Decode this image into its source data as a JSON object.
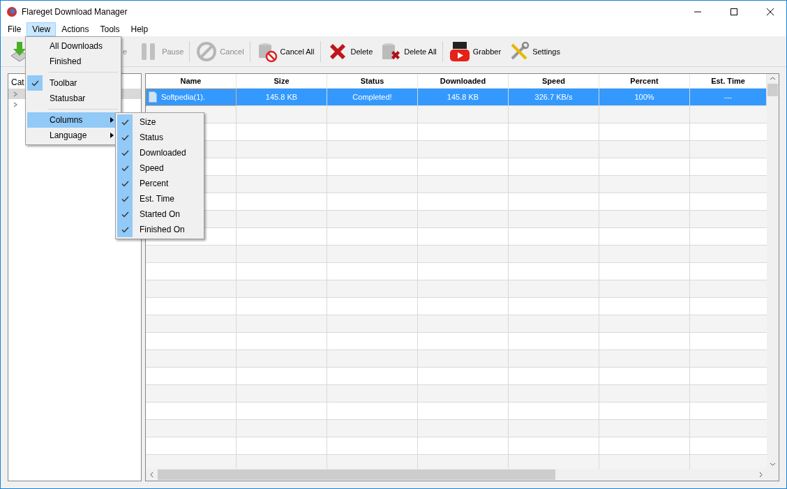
{
  "window": {
    "title": "Flareget Download Manager"
  },
  "menubar": [
    {
      "label": "File",
      "selected": false
    },
    {
      "label": "View",
      "selected": true
    },
    {
      "label": "Actions",
      "selected": false
    },
    {
      "label": "Tools",
      "selected": false
    },
    {
      "label": "Help",
      "selected": false
    }
  ],
  "toolbar": [
    {
      "kind": "add",
      "disabled": false
    },
    {
      "kind": "resume",
      "label": "e",
      "disabled": true
    },
    {
      "kind": "pause",
      "label": "Pause",
      "disabled": true
    },
    {
      "kind": "cancel",
      "label": "Cancel",
      "disabled": true
    },
    {
      "kind": "cancel-all",
      "label": "Cancel All",
      "disabled": false
    },
    {
      "kind": "delete",
      "label": "Delete",
      "disabled": false
    },
    {
      "kind": "delete-all",
      "label": "Delete All",
      "disabled": false
    },
    {
      "kind": "youtube",
      "label": "Grabber",
      "disabled": false
    },
    {
      "kind": "settings",
      "label": "Settings",
      "disabled": false
    }
  ],
  "sidebar": {
    "header": "Cat",
    "items": [
      {
        "selected": true,
        "expanded": false
      },
      {
        "selected": false,
        "expanded": false
      }
    ]
  },
  "table": {
    "columns": [
      "Name",
      "Size",
      "Status",
      "Downloaded",
      "Speed",
      "Percent",
      "Est. Time"
    ],
    "rows": [
      {
        "selected": true,
        "cells": [
          "Softpedia(1).",
          "145.8 KB",
          "Completed!",
          "145.8 KB",
          "326.7 KB/s",
          "100%",
          "---"
        ]
      }
    ]
  },
  "view_menu": [
    {
      "kind": "item",
      "label": "All Downloads",
      "checked": false,
      "selected": false,
      "submenu": false
    },
    {
      "kind": "item",
      "label": "Finished",
      "checked": false,
      "selected": false,
      "submenu": false
    },
    {
      "kind": "separator"
    },
    {
      "kind": "item",
      "label": "Toolbar",
      "checked": true,
      "selected": false,
      "submenu": false
    },
    {
      "kind": "item",
      "label": "Statusbar",
      "checked": false,
      "selected": false,
      "submenu": false
    },
    {
      "kind": "separator"
    },
    {
      "kind": "item",
      "label": "Columns",
      "checked": false,
      "selected": true,
      "submenu": true
    },
    {
      "kind": "item",
      "label": "Language",
      "checked": false,
      "selected": false,
      "submenu": true
    }
  ],
  "columns_menu": [
    {
      "label": "Size",
      "checked": true
    },
    {
      "label": "Status",
      "checked": true
    },
    {
      "label": "Downloaded",
      "checked": true
    },
    {
      "label": "Speed",
      "checked": true
    },
    {
      "label": "Percent",
      "checked": true
    },
    {
      "label": "Est. Time",
      "checked": true
    },
    {
      "label": "Started On",
      "checked": true
    },
    {
      "label": "Finished On",
      "checked": true
    }
  ]
}
